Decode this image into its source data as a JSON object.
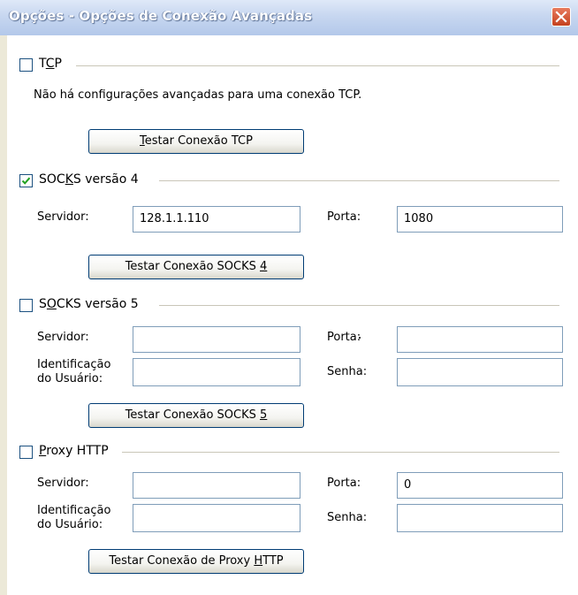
{
  "window": {
    "title": "Opções - Opções de Conexão Avançadas"
  },
  "tcp": {
    "label_pre": "T",
    "label_u": "C",
    "label_post": "P",
    "checked": false,
    "note": "Não há configurações avançadas para uma conexão TCP.",
    "test_u": "T",
    "test_rest": "estar Conexão TCP"
  },
  "socks4": {
    "label_pre": "SOC",
    "label_u": "K",
    "label_post": "S versão 4",
    "checked": true,
    "server_label": "Servidor:",
    "server_value": "128.1.1.110",
    "port_label": "Porta:",
    "port_value": "1080",
    "test_pre": "Testar Conexão SOCKS ",
    "test_u": "4"
  },
  "socks5": {
    "label_pre": "S",
    "label_u": "O",
    "label_post": "CKS versão 5",
    "checked": false,
    "server_label": "Servidor:",
    "server_value": "",
    "port_label": "Porta:",
    "port_value": "",
    "user_label_1": "Identificação",
    "user_label_2": "do Usuário:",
    "user_value": "",
    "password_label": "Senha:",
    "password_value": "",
    "test_pre": "Testar Conexão SOCKS ",
    "test_u": "5"
  },
  "http": {
    "label_u": "P",
    "label_post": "roxy HTTP",
    "checked": false,
    "server_label": "Servidor:",
    "server_value": "",
    "port_label": "Porta:",
    "port_value": "0",
    "user_label_1": "Identificação",
    "user_label_2": "do Usuário:",
    "user_value": "",
    "password_label": "Senha:",
    "password_value": "",
    "test_pre": "Testar Conexão de Proxy ",
    "test_u": "H",
    "test_post": "TTP"
  }
}
